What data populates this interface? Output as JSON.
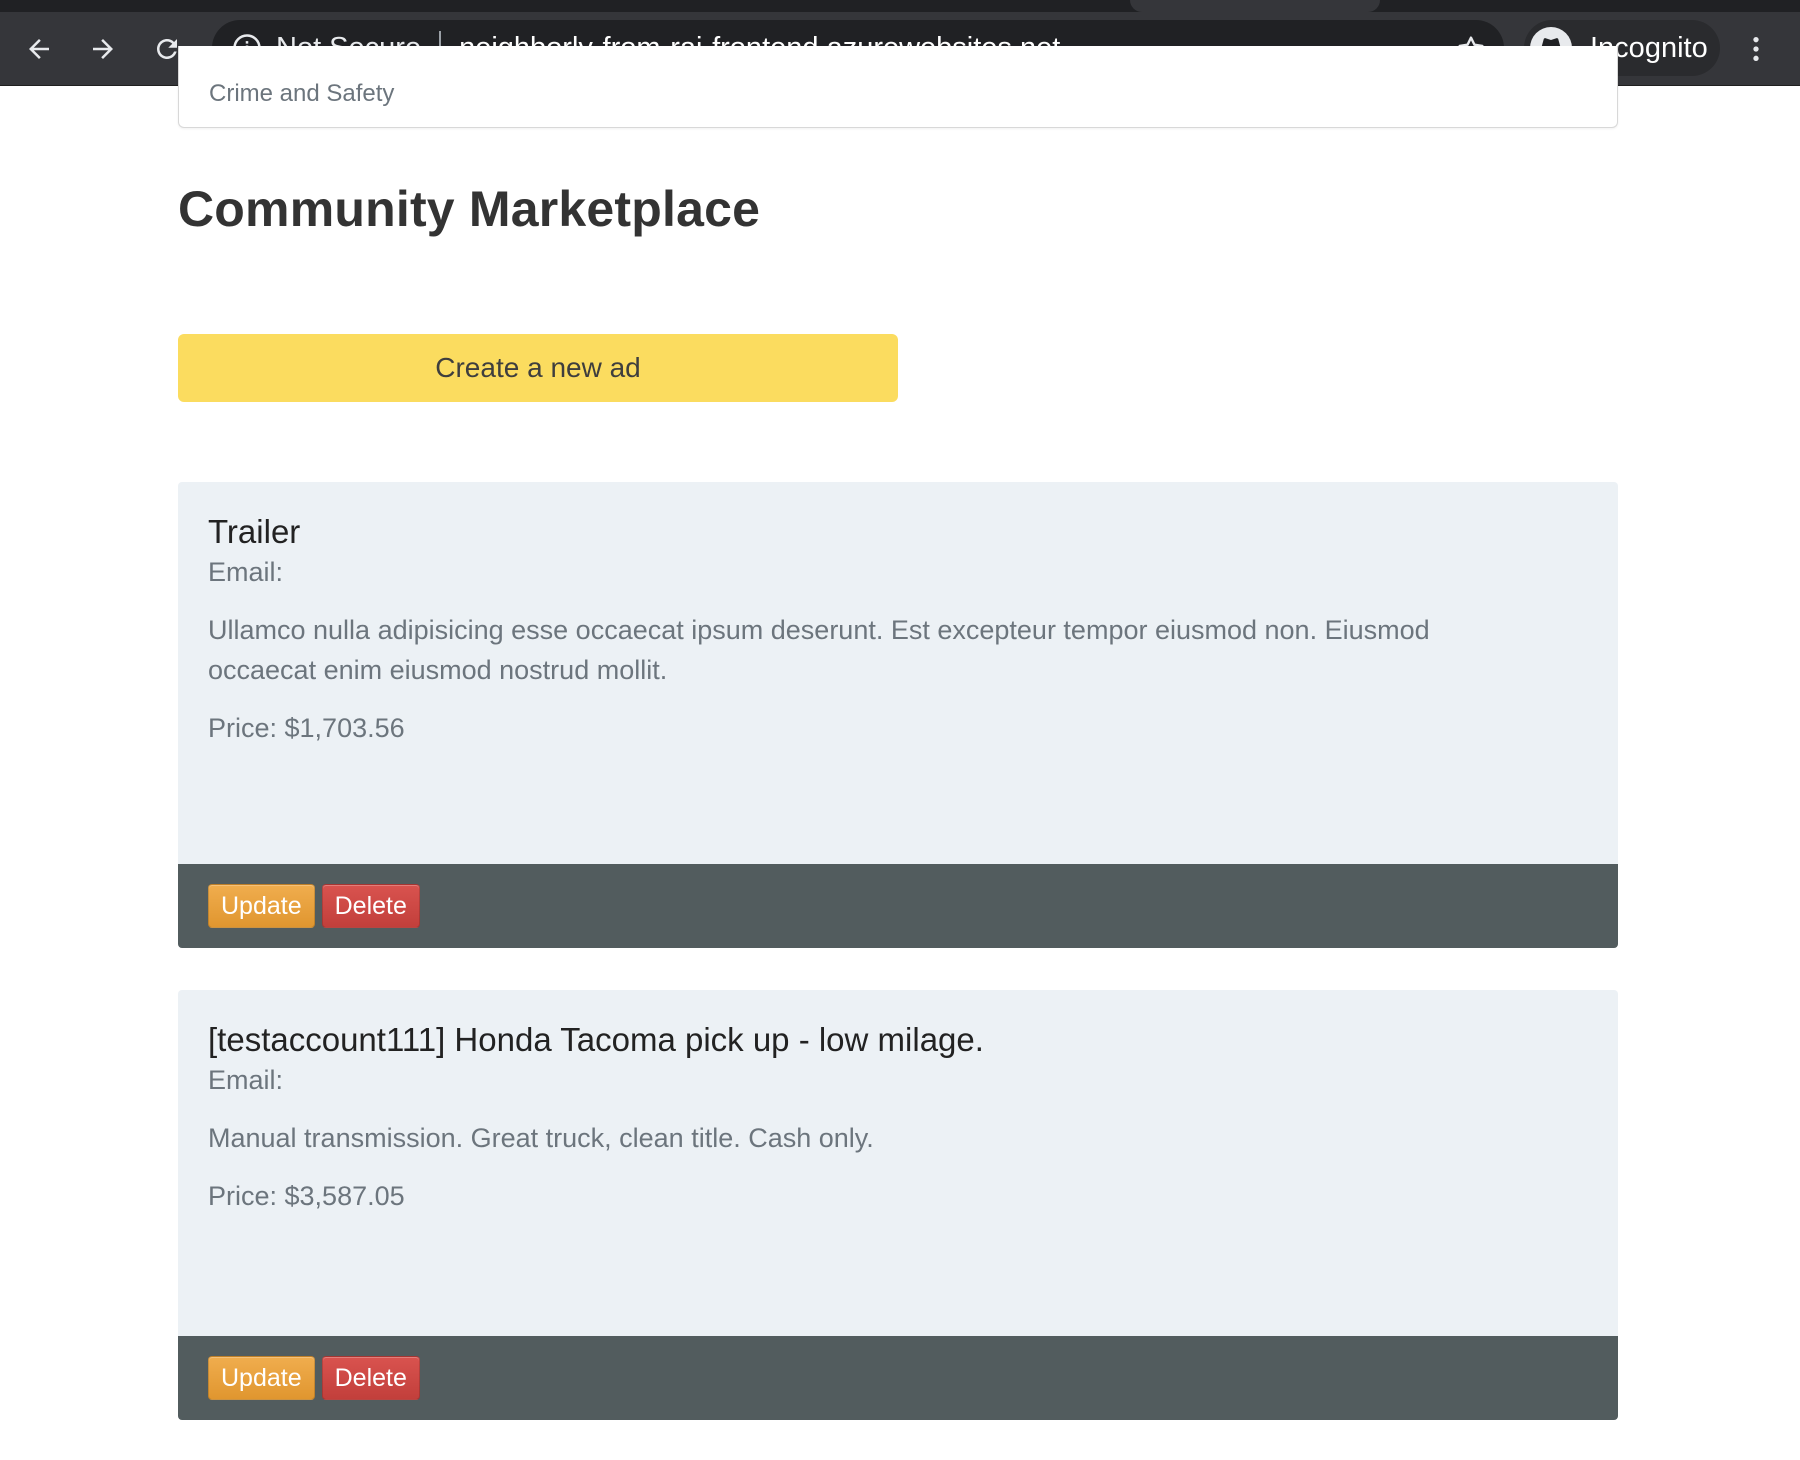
{
  "browser": {
    "security_label": "Not Secure",
    "url": "neighborly-from-raj-frontend.azurewebsites.net",
    "profile_label": "Incognito",
    "icons": [
      "back-arrow-icon",
      "forward-arrow-icon",
      "reload-icon",
      "info-icon",
      "star-icon",
      "incognito-icon",
      "more-vertical-icon"
    ]
  },
  "page": {
    "previous_card_text": "Crime and Safety",
    "title": "Community Marketplace",
    "create_button_label": "Create a new ad",
    "colors": {
      "create_button": "#fbdc5f",
      "card_background": "#ecf1f5",
      "card_footer": "#525c5e",
      "update_button": "#f0ad4e",
      "delete_button": "#d9534f"
    }
  },
  "ads": [
    {
      "title": "Trailer",
      "email": "Email:",
      "description": "Ullamco nulla adipisicing esse occaecat ipsum deserunt. Est excepteur tempor eiusmod non. Eiusmod occaecat enim eiusmod nostrud mollit.",
      "price": "Price: $1,703.56",
      "update_label": "Update",
      "delete_label": "Delete"
    },
    {
      "title": "[testaccount111] Honda Tacoma pick up - low milage.",
      "email": "Email:",
      "description": "Manual transmission. Great truck, clean title. Cash only.",
      "price": "Price: $3,587.05",
      "update_label": "Update",
      "delete_label": "Delete"
    }
  ]
}
